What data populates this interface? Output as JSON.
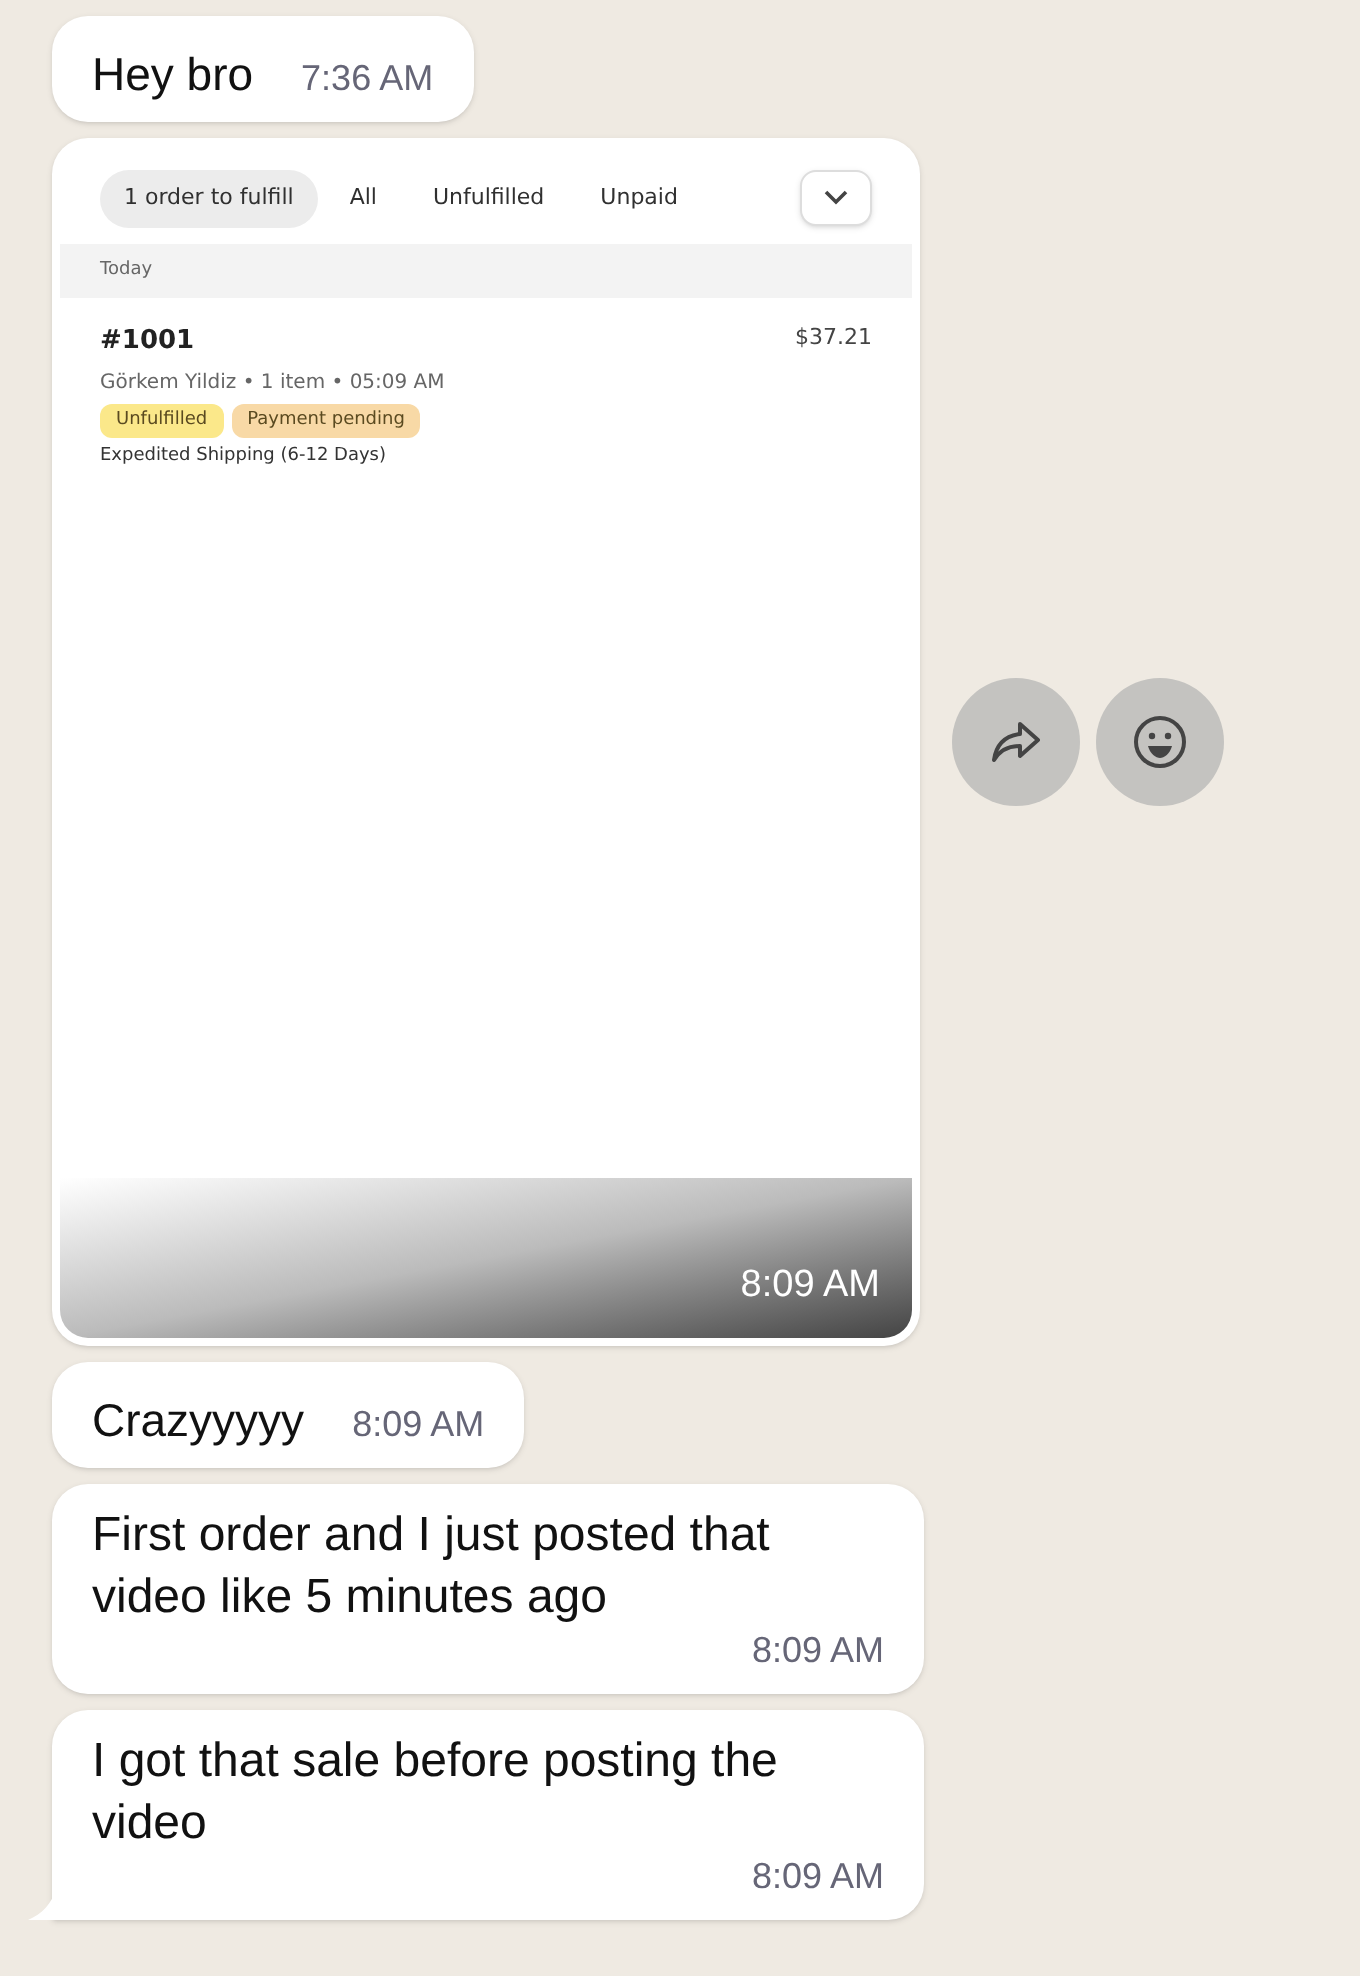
{
  "messages": [
    {
      "kind": "text",
      "text": "Hey bro",
      "time": "7:36 AM"
    },
    {
      "kind": "image",
      "time": "8:09 AM",
      "screenshot": {
        "tabs": [
          {
            "label": "1 order to fulfill",
            "selected": true
          },
          {
            "label": "All",
            "selected": false
          },
          {
            "label": "Unfulfilled",
            "selected": false
          },
          {
            "label": "Unpaid",
            "selected": false
          }
        ],
        "section": "Today",
        "order": {
          "number": "#1001",
          "price": "$37.21",
          "meta": "Görkem Yildiz • 1 item • 05:09 AM",
          "badges": [
            {
              "text": "Unfulfilled",
              "color": "#fbe88a"
            },
            {
              "text": "Payment pending",
              "color": "#f8d9a6"
            }
          ],
          "shipping": "Expedited Shipping (6-12 Days)"
        }
      }
    },
    {
      "kind": "text",
      "text": "Crazyyyyy",
      "time": "8:09 AM"
    },
    {
      "kind": "text",
      "text": "First order and I just posted that video like 5 minutes ago",
      "time": "8:09 AM"
    },
    {
      "kind": "text",
      "text": "I got that sale before posting the video",
      "time": "8:09 AM",
      "tail": true
    }
  ]
}
